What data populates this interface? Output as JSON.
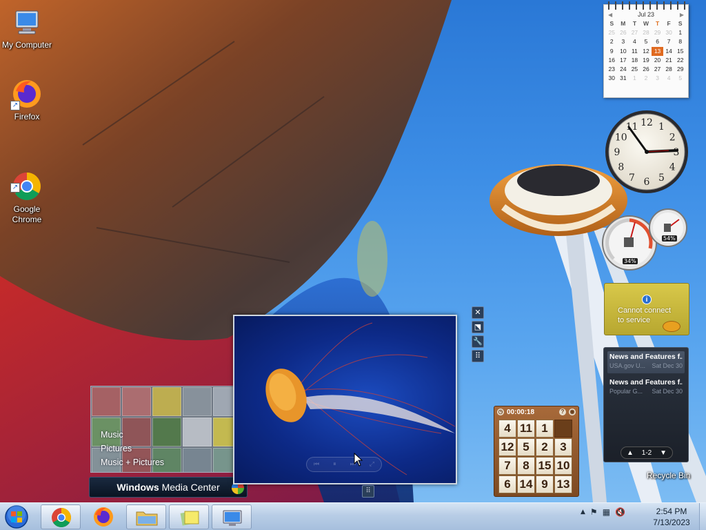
{
  "desktop": {
    "icons": [
      {
        "label": "My Computer",
        "icon": "computer-icon"
      },
      {
        "label": "Firefox",
        "icon": "firefox-icon"
      },
      {
        "label": "Google\nChrome",
        "icon": "chrome-icon"
      }
    ],
    "recycle_bin": "Recycle Bin"
  },
  "calendar": {
    "month": "Jul 23",
    "prev": "◀",
    "next": "▶",
    "days_of_week": [
      "S",
      "M",
      "T",
      "W",
      "T",
      "F",
      "S"
    ],
    "weeks": [
      [
        "25",
        "26",
        "27",
        "28",
        "29",
        "30",
        "1"
      ],
      [
        "2",
        "3",
        "4",
        "5",
        "6",
        "7",
        "8"
      ],
      [
        "9",
        "10",
        "11",
        "12",
        "13",
        "14",
        "15"
      ],
      [
        "16",
        "17",
        "18",
        "19",
        "20",
        "21",
        "22"
      ],
      [
        "23",
        "24",
        "25",
        "26",
        "27",
        "28",
        "29"
      ],
      [
        "30",
        "31",
        "1",
        "2",
        "3",
        "4",
        "5"
      ]
    ],
    "today": "13"
  },
  "clock": {
    "numerals": [
      "12",
      "1",
      "2",
      "3",
      "4",
      "5",
      "6",
      "7",
      "8",
      "9",
      "10",
      "11"
    ]
  },
  "cpu_meter": {
    "cpu": "34%",
    "memory": "54%"
  },
  "weather": {
    "info": "i",
    "message_line1": "Cannot connect",
    "message_line2": "to service"
  },
  "feeds": {
    "items": [
      {
        "title": "News and Features f...",
        "source": "USA.gov U...",
        "date": "Sat Dec 30"
      },
      {
        "title": "News and Features f...",
        "source": "Popular G...",
        "date": "Sat Dec 30"
      }
    ],
    "page": "1-2",
    "prev": "▲",
    "next": "▼"
  },
  "puzzle": {
    "timer": "00:00:18",
    "help": "?",
    "tiles": [
      "4",
      "11",
      "1",
      "",
      "12",
      "5",
      "2",
      "3",
      "7",
      "8",
      "15",
      "10",
      "6",
      "14",
      "9",
      "13"
    ]
  },
  "media_center": {
    "menu": [
      "Music",
      "Pictures",
      "Music + Pictures"
    ],
    "brand_bold": "Windows",
    "brand_rest": " Media Center"
  },
  "slideshow": {
    "controls": [
      "⏮",
      "⏸",
      "⏭",
      "⤢"
    ]
  },
  "gadget_tools": {
    "close": "✕",
    "options": "⬔",
    "settings": "🔧",
    "drag": "⠿"
  },
  "taskbar": {
    "time": "2:54 PM",
    "date": "7/13/2023",
    "tray_arrow": "▲"
  }
}
